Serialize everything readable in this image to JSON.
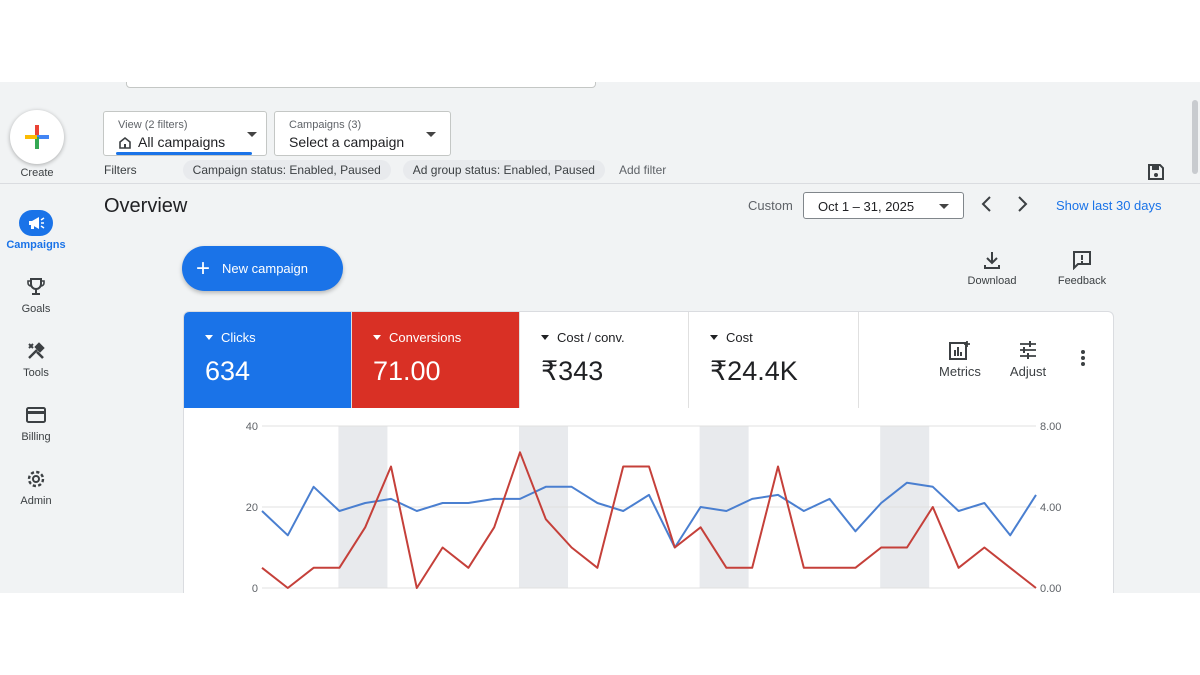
{
  "rail": {
    "create": "Create",
    "items": [
      {
        "label": "Campaigns",
        "icon": "megaphone-icon",
        "active": true
      },
      {
        "label": "Goals",
        "icon": "trophy-icon"
      },
      {
        "label": "Tools",
        "icon": "tools-icon"
      },
      {
        "label": "Billing",
        "icon": "credit-card-icon"
      },
      {
        "label": "Admin",
        "icon": "gear-icon"
      }
    ]
  },
  "filters": {
    "view_small": "View (2 filters)",
    "view_value": "All campaigns",
    "campaigns_small": "Campaigns (3)",
    "campaigns_value": "Select a campaign",
    "label": "Filters",
    "chips": [
      "Campaign status: Enabled, Paused",
      "Ad group status: Enabled, Paused"
    ],
    "add_filter": "Add filter"
  },
  "overview": {
    "title": "Overview",
    "custom": "Custom",
    "date_range": "Oct 1 – 31, 2025",
    "show_last": "Show last 30 days",
    "new_campaign": "New campaign",
    "download": "Download",
    "feedback": "Feedback"
  },
  "scorecards": [
    {
      "name": "Clicks",
      "value": "634",
      "color": "#1a73e8"
    },
    {
      "name": "Conversions",
      "value": "71.00",
      "color": "#d93025"
    },
    {
      "name": "Cost / conv.",
      "value": "₹343"
    },
    {
      "name": "Cost",
      "value": "₹24.4K"
    }
  ],
  "card_tools": {
    "metrics": "Metrics",
    "adjust": "Adjust"
  },
  "chart_data": {
    "type": "line",
    "x": [
      1,
      2,
      3,
      4,
      5,
      6,
      7,
      8,
      9,
      10,
      11,
      12,
      13,
      14,
      15,
      16,
      17,
      18,
      19,
      20,
      21,
      22,
      23,
      24,
      25,
      26,
      27,
      28,
      29,
      30,
      31
    ],
    "y_left_ticks": [
      "40",
      "20",
      "0"
    ],
    "y_right_ticks": [
      "8.00",
      "4.00",
      "0.00"
    ],
    "ylim_left": [
      0,
      40
    ],
    "ylim_right": [
      0,
      8
    ],
    "weekend_bands": [
      [
        4,
        5
      ],
      [
        11,
        12
      ],
      [
        18,
        19
      ],
      [
        25,
        26
      ]
    ],
    "series": [
      {
        "name": "Clicks",
        "axis": "left",
        "color": "#4a7fd0",
        "values": [
          19,
          13,
          25,
          19,
          21,
          22,
          19,
          21,
          21,
          22,
          22,
          25,
          25,
          21,
          19,
          23,
          10,
          20,
          19,
          22,
          23,
          19,
          22,
          14,
          21,
          26,
          25,
          19,
          21,
          13,
          23
        ]
      },
      {
        "name": "Conversions",
        "axis": "right",
        "color": "#c5403a",
        "values": [
          1,
          0,
          1,
          1,
          3,
          6,
          0,
          2,
          1,
          3,
          6.7,
          3.4,
          2,
          1,
          6,
          6,
          2,
          3,
          1,
          1,
          6,
          1,
          1,
          1,
          2,
          2,
          4,
          1,
          2,
          1,
          0
        ]
      }
    ]
  }
}
